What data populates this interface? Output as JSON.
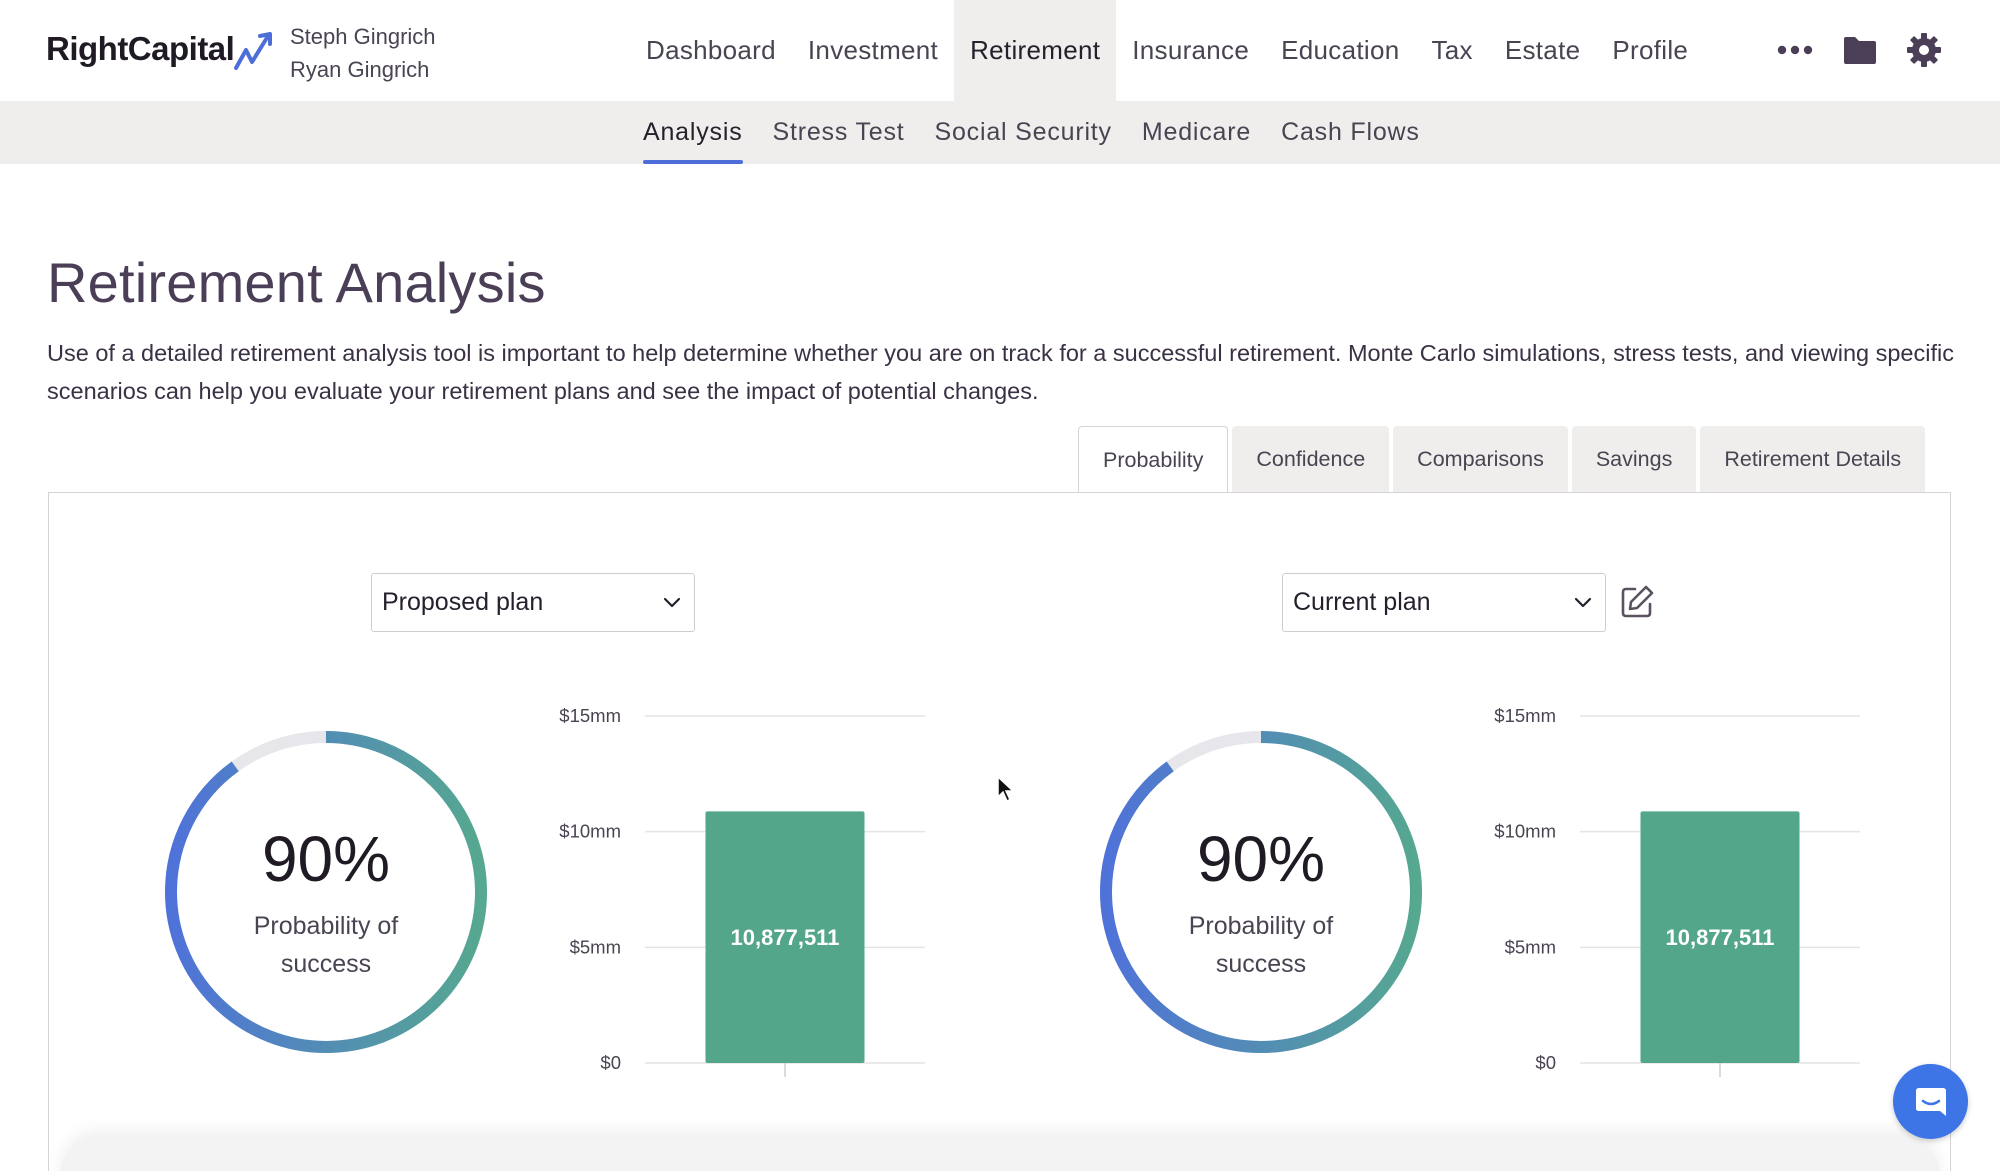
{
  "brand": {
    "name": "RightCapital",
    "accent": "#4d6ed8"
  },
  "clients": [
    "Steph Gingrich",
    "Ryan Gingrich"
  ],
  "main_nav": [
    {
      "label": "Dashboard",
      "active": false
    },
    {
      "label": "Investment",
      "active": false
    },
    {
      "label": "Retirement",
      "active": true
    },
    {
      "label": "Insurance",
      "active": false
    },
    {
      "label": "Education",
      "active": false
    },
    {
      "label": "Tax",
      "active": false
    },
    {
      "label": "Estate",
      "active": false
    },
    {
      "label": "Profile",
      "active": false
    }
  ],
  "nav_icons": [
    "more-icon",
    "folder-icon",
    "gear-icon"
  ],
  "sub_nav": [
    {
      "label": "Analysis",
      "active": true
    },
    {
      "label": "Stress Test",
      "active": false
    },
    {
      "label": "Social Security",
      "active": false
    },
    {
      "label": "Medicare",
      "active": false
    },
    {
      "label": "Cash Flows",
      "active": false
    }
  ],
  "page": {
    "title": "Retirement Analysis",
    "description": "Use of a detailed retirement analysis tool is important to help determine whether you are on track for a successful retirement. Monte Carlo simulations, stress tests, and viewing specific scenarios can help you evaluate your retirement plans and see the impact of potential changes."
  },
  "tabs": [
    {
      "label": "Probability",
      "active": true
    },
    {
      "label": "Confidence",
      "active": false
    },
    {
      "label": "Comparisons",
      "active": false
    },
    {
      "label": "Savings",
      "active": false
    },
    {
      "label": "Retirement Details",
      "active": false
    }
  ],
  "plans": [
    {
      "select_value": "Proposed plan",
      "probability_text": "90%",
      "probability_fraction": 0.9,
      "probability_label": "Probability of success"
    },
    {
      "select_value": "Current plan",
      "probability_text": "90%",
      "probability_fraction": 0.9,
      "probability_label": "Probability of success"
    }
  ],
  "colors": {
    "bar": "#54a68a",
    "ring_start": "#4f72d9",
    "ring_end": "#56a890",
    "ring_track": "#e7e6ea"
  },
  "chart_data": [
    {
      "type": "bar",
      "categories": [
        ""
      ],
      "values": [
        10877511
      ],
      "data_labels": [
        "10,877,511"
      ],
      "y_ticks": [
        "$0",
        "$5mm",
        "$10mm",
        "$15mm"
      ],
      "ylim": [
        0,
        15000000
      ],
      "grid": true
    },
    {
      "type": "bar",
      "categories": [
        ""
      ],
      "values": [
        10877511
      ],
      "data_labels": [
        "10,877,511"
      ],
      "y_ticks": [
        "$0",
        "$5mm",
        "$10mm",
        "$15mm"
      ],
      "ylim": [
        0,
        15000000
      ],
      "grid": true
    }
  ]
}
